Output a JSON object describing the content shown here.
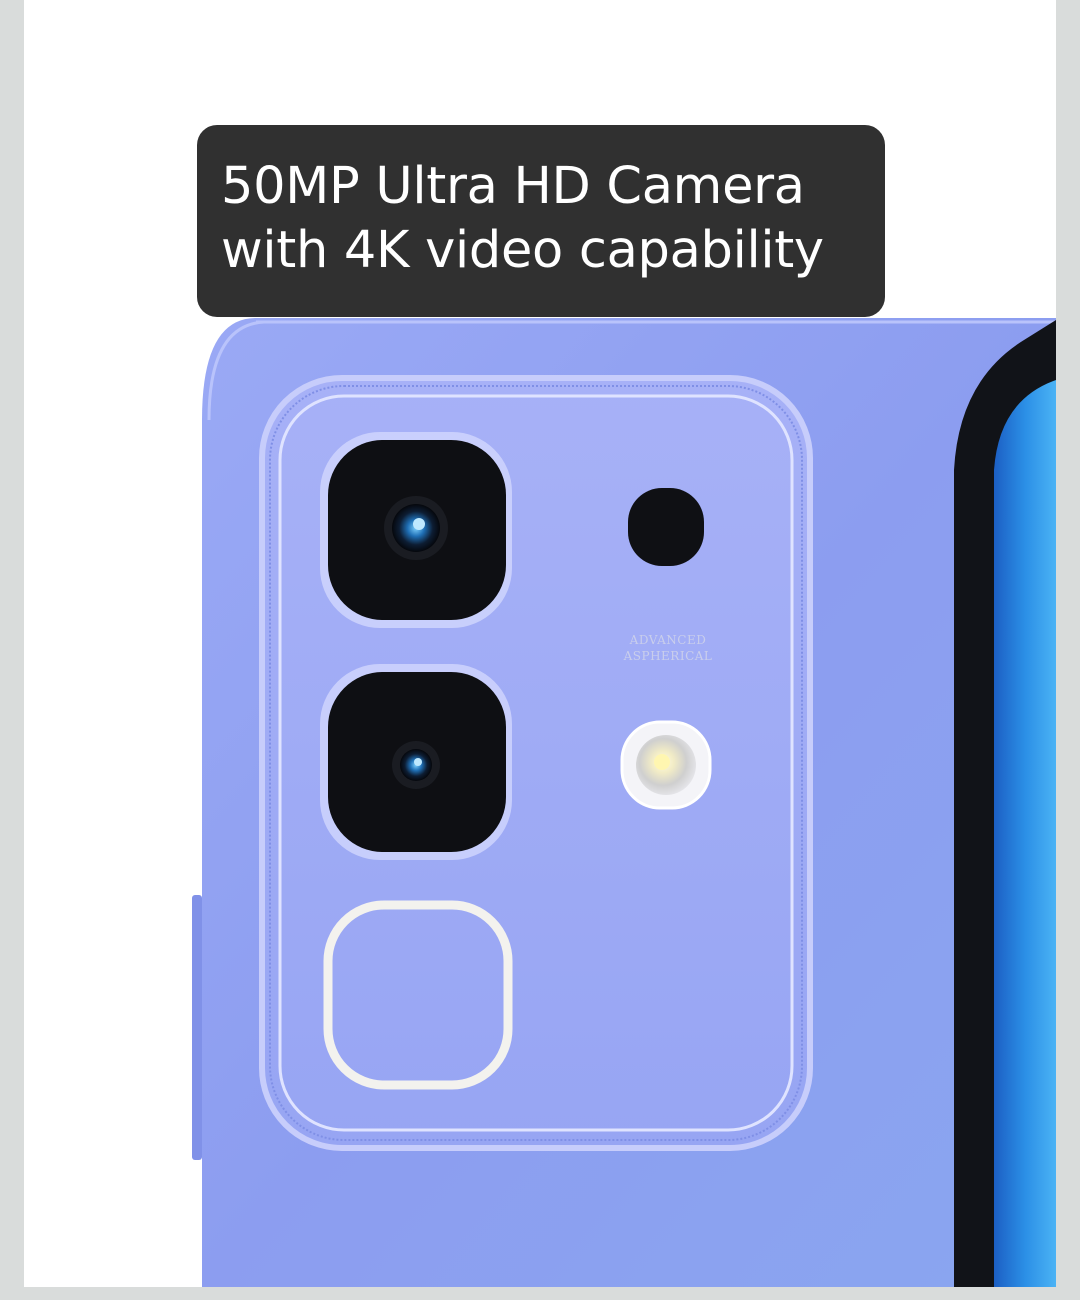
{
  "caption": {
    "line1": "50MP Ultra HD Camera",
    "line2": "with 4K video capability"
  },
  "lens_engraving": {
    "line1": "ADVANCED",
    "line2": "ASPHERICAL"
  },
  "colors": {
    "frame": "#d9dcdb",
    "background": "#ffffff",
    "phone_body": "#8e9ff2",
    "caption_bg": "#303030",
    "caption_text": "#ffffff"
  }
}
